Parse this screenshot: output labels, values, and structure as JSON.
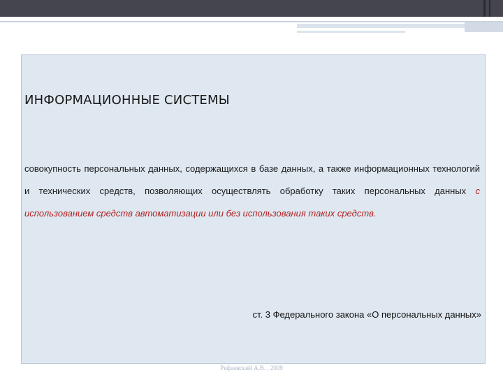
{
  "slide": {
    "title": "ИНФОРМАЦИОННЫЕ СИСТЕМЫ",
    "definition_plain": "совокупность персональных данных, содержащихся в базе данных, а также информационных технологий и технических средств, позволяющих осуществлять обработку таких персональных данных ",
    "definition_emphasis": "с использованием средств автоматизации или без использования таких средств.",
    "source": "ст. 3 Федерального закона «О персональных данных»",
    "footer": "Рифаевский А.В. , 2009"
  },
  "colors": {
    "topbar": "#45454f",
    "panel_bg": "#dfe8f1",
    "emphasis": "#b22222"
  }
}
